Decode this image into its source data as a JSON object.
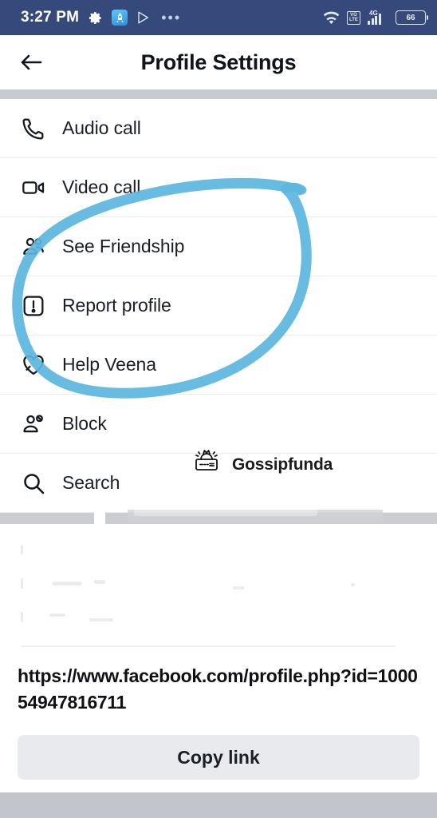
{
  "status_bar": {
    "time": "3:27 PM",
    "battery_level": "66",
    "network_type": "4G",
    "volte_line1": "VO",
    "volte_line2": "LTE",
    "overflow": "•••",
    "icons": [
      "gear-icon",
      "launcher-icon",
      "play-store-icon",
      "overflow-icon",
      "wifi-icon",
      "volte-icon",
      "signal-icon",
      "battery-icon"
    ],
    "background_color": "#35497B"
  },
  "header": {
    "title": "Profile Settings",
    "back_icon": "back-arrow-icon"
  },
  "menu": {
    "items": [
      {
        "label": "Audio call",
        "icon": "phone-icon"
      },
      {
        "label": "Video call",
        "icon": "video-camera-icon"
      },
      {
        "label": "See Friendship",
        "icon": "people-icon"
      },
      {
        "label": "Report profile",
        "icon": "report-exclamation-icon"
      },
      {
        "label": "Help Veena",
        "icon": "heart-icon"
      },
      {
        "label": "Block",
        "icon": "person-block-icon"
      },
      {
        "label": "Search",
        "icon": "search-icon"
      }
    ]
  },
  "annotation": {
    "shape": "hand-drawn-circle",
    "color": "#5CB6DE",
    "encircles": [
      "See Friendship",
      "Report profile",
      "Help Veena"
    ]
  },
  "watermark": {
    "text": "Gossipfunda",
    "icon": "gossipfunda-logo-icon"
  },
  "share": {
    "url": "https://www.facebook.com/profile.php?id=100054947816711",
    "copy_label": "Copy link"
  },
  "colors": {
    "status_bar": "#35497B",
    "annotation_blue": "#5CB6DE",
    "divider": "#ECECEE",
    "button_bg": "#E9EAED",
    "gray_band": "#C8CAD1"
  }
}
